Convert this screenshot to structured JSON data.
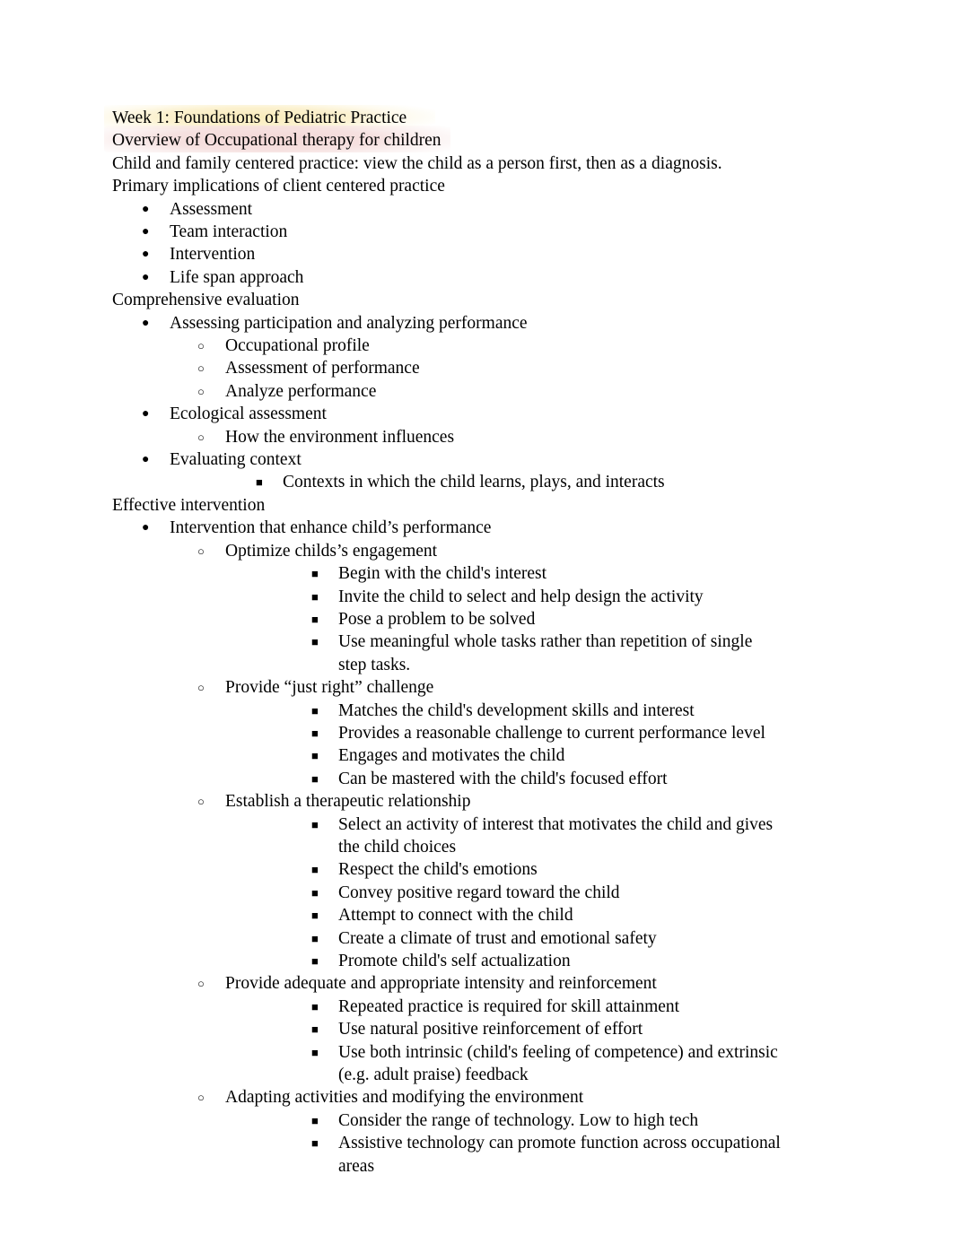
{
  "document": {
    "headings": [
      {
        "text": "Week 1: Foundations of Pediatric Practice",
        "highlight": "#faecba"
      },
      {
        "text": "Overview of Occupational therapy for children",
        "highlight": "#f3d6d5"
      }
    ],
    "intro_paragraph": "Child and family centered practice: view the child as a person first, then as a diagnosis. Primary implications of client centered practice",
    "implications": [
      "Assessment",
      "Team interaction",
      "Intervention",
      "Life span approach"
    ],
    "section_comprehensive": {
      "heading": "Comprehensive evaluation",
      "items": [
        {
          "text": "Assessing participation and analyzing performance",
          "children": [
            "Occupational profile",
            "Assessment of performance",
            "Analyze performance"
          ]
        },
        {
          "text": "Ecological assessment",
          "children": [
            "How the environment influences"
          ]
        },
        {
          "text": "Evaluating context",
          "squares": [
            "Contexts in which the child learns, plays, and interacts"
          ]
        }
      ]
    },
    "section_effective": {
      "heading": "Effective intervention",
      "lead": "Intervention that enhance child’s performance",
      "groups": [
        {
          "title": "Optimize childs’s engagement",
          "points": [
            "Begin with the child's interest",
            "Invite the child to select and help design the activity",
            "Pose a problem to be solved",
            "Use meaningful whole tasks rather than repetition of single step tasks."
          ]
        },
        {
          "title": "Provide “just right” challenge",
          "points": [
            "Matches the child's development skills and interest",
            "Provides a reasonable challenge to current performance level",
            "Engages and motivates the child",
            "Can be mastered with the child's focused effort"
          ]
        },
        {
          "title": "Establish a therapeutic relationship",
          "points": [
            "Select an activity of interest that motivates the child and gives the child choices",
            "Respect the child's emotions",
            "Convey positive regard toward the child",
            "Attempt to connect with the child",
            "Create a climate of trust and emotional safety",
            "Promote child's self actualization"
          ]
        },
        {
          "title": "Provide adequate and appropriate intensity and reinforcement",
          "points": [
            "Repeated practice is required for skill attainment",
            "Use natural positive reinforcement of effort",
            "Use both intrinsic (child's feeling of competence) and extrinsic (e.g. adult praise) feedback"
          ]
        },
        {
          "title": "Adapting activities and modifying the environment",
          "points": [
            "Consider the range of technology. Low to high tech",
            "Assistive technology can promote function across occupational areas"
          ]
        }
      ]
    },
    "bullet_glyphs": {
      "level1": "●",
      "level2": "○",
      "level3": "■"
    }
  }
}
